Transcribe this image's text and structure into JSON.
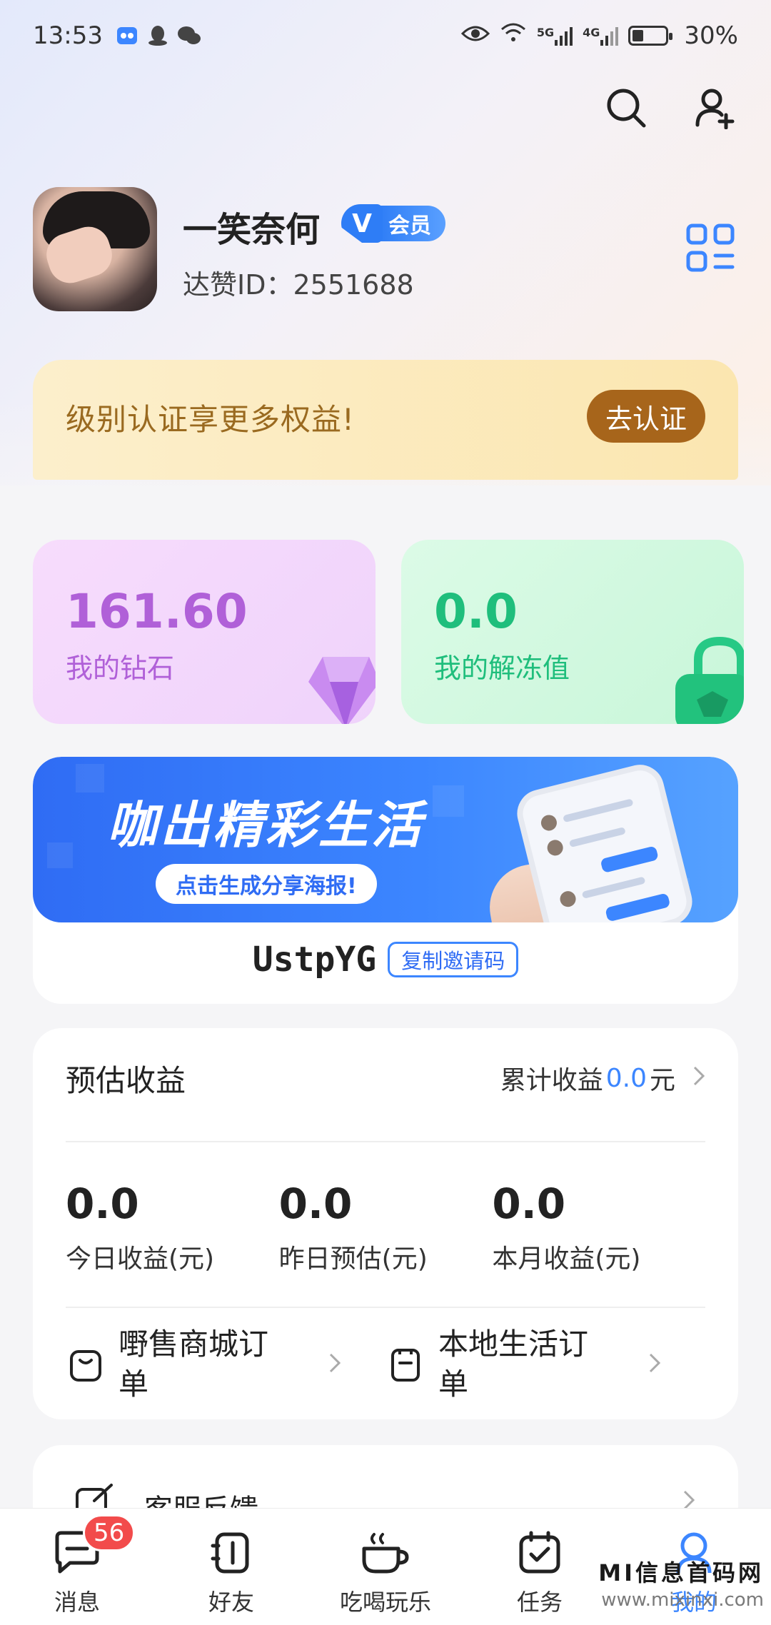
{
  "status_bar": {
    "time": "13:53",
    "signal_5g": "5G",
    "signal_4g": "4G",
    "battery": "30%"
  },
  "profile": {
    "name": "一笑奈何",
    "vip_label": "会员",
    "vip_mark": "V",
    "uid": "达赞ID：2551688"
  },
  "cert_banner": {
    "text": "级别认证享更多权益!",
    "button": "去认证"
  },
  "wallet": {
    "diamond_value": "161.60",
    "diamond_label": "我的钻石",
    "unfreeze_value": "0.0",
    "unfreeze_label": "我的解冻值"
  },
  "share": {
    "title": "咖出精彩生活",
    "pill": "点击生成分享海报!",
    "invite_code": "UstpYG",
    "copy_button": "复制邀请码"
  },
  "earnings": {
    "title": "预估收益",
    "total_prefix": "累计收益",
    "total_value": "0.0",
    "total_unit": "元",
    "stats": [
      {
        "value": "0.0",
        "label": "今日收益(元)"
      },
      {
        "value": "0.0",
        "label": "昨日预估(元)"
      },
      {
        "value": "0.0",
        "label": "本月收益(元)"
      }
    ],
    "orders": [
      {
        "label": "嘢售商城订单"
      },
      {
        "label": "本地生活订单"
      }
    ]
  },
  "service": {
    "label": "客服反馈"
  },
  "nav": {
    "items": [
      {
        "label": "消息",
        "badge": "56"
      },
      {
        "label": "好友"
      },
      {
        "label": "吃喝玩乐"
      },
      {
        "label": "任务"
      },
      {
        "label": "我的"
      }
    ]
  },
  "watermark": {
    "line1": "MI信息首码网",
    "line2": "www.mixinxi.com"
  },
  "colors": {
    "accent": "#3c86ff",
    "cert_button": "#a7651b",
    "diamond": "#b060d8",
    "unfreeze": "#1fbe7c",
    "badge": "#f24b4b"
  }
}
